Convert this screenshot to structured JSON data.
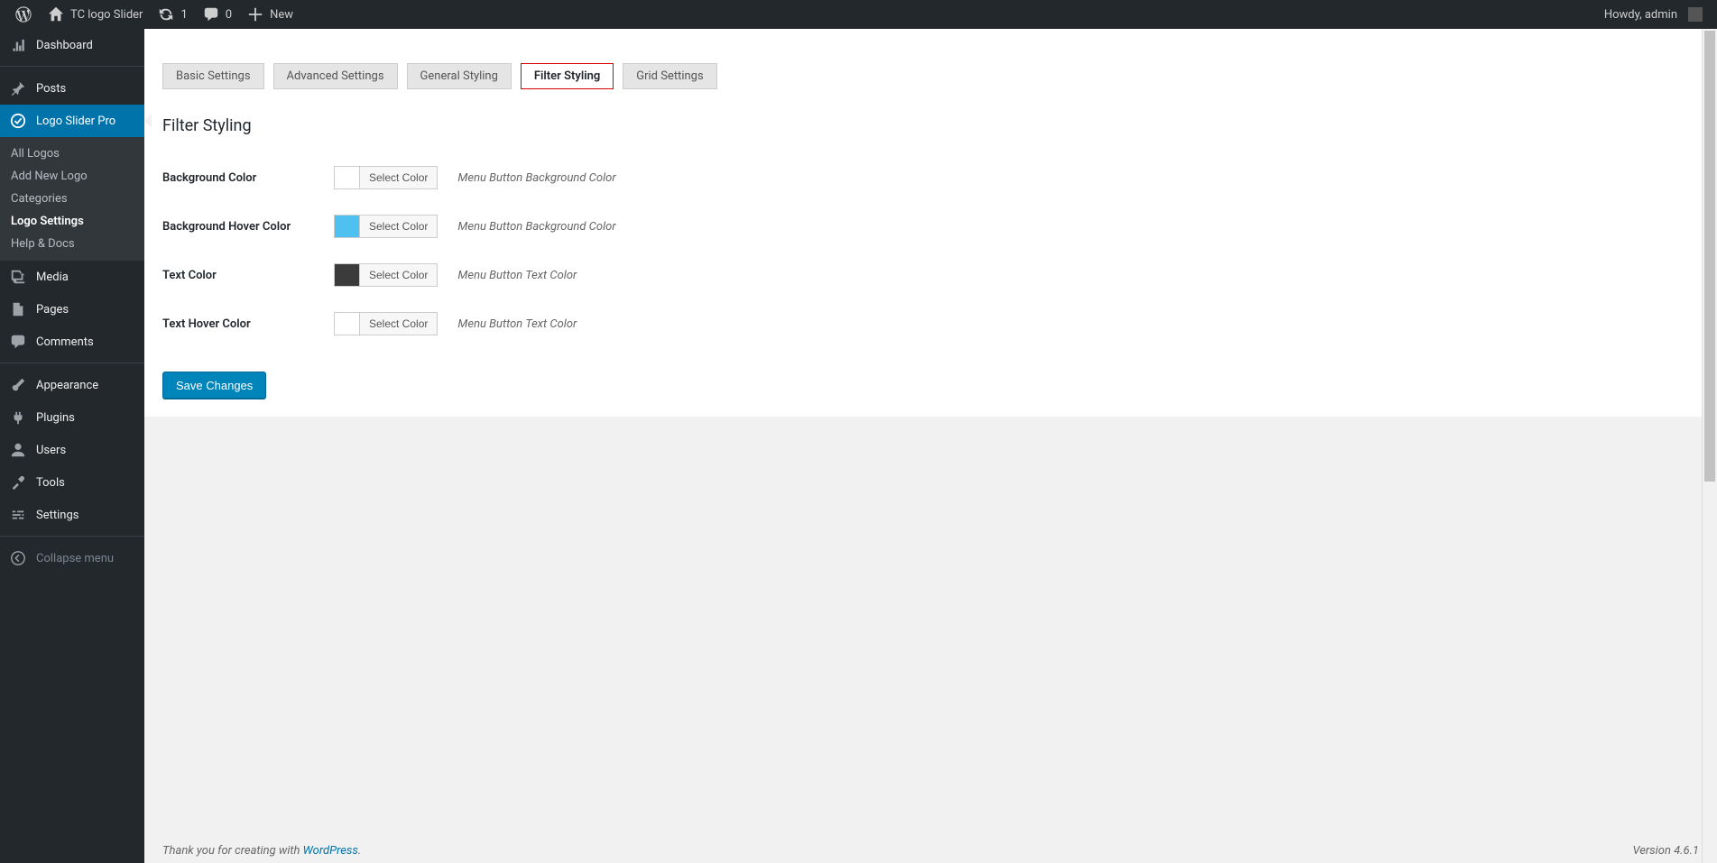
{
  "adminbar": {
    "site_name": "TC logo Slider",
    "updates": "1",
    "comments": "0",
    "new_label": "New",
    "greeting": "Howdy, admin"
  },
  "sidebar": {
    "dashboard": "Dashboard",
    "posts": "Posts",
    "logo_slider": "Logo Slider Pro",
    "submenu": {
      "all_logos": "All Logos",
      "add_new": "Add New Logo",
      "categories": "Categories",
      "settings": "Logo Settings",
      "help": "Help & Docs"
    },
    "media": "Media",
    "pages": "Pages",
    "comments": "Comments",
    "appearance": "Appearance",
    "plugins": "Plugins",
    "users": "Users",
    "tools": "Tools",
    "settings": "Settings",
    "collapse": "Collapse menu"
  },
  "tabs": {
    "basic": "Basic Settings",
    "advanced": "Advanced Settings",
    "general": "General Styling",
    "filter": "Filter Styling",
    "grid": "Grid Settings"
  },
  "section": {
    "title": "Filter Styling"
  },
  "fields": {
    "bg_color": {
      "label": "Background Color",
      "btn": "Select Color",
      "desc": "Menu Button Background Color",
      "swatch": "#ffffff"
    },
    "bg_hover": {
      "label": "Background Hover Color",
      "btn": "Select Color",
      "desc": "Menu Button Background Color",
      "swatch": "#4fc1f0"
    },
    "text_color": {
      "label": "Text Color",
      "btn": "Select Color",
      "desc": "Menu Button Text Color",
      "swatch": "#3b3b3b"
    },
    "text_hover": {
      "label": "Text Hover Color",
      "btn": "Select Color",
      "desc": "Menu Button Text Color",
      "swatch": "#ffffff"
    }
  },
  "actions": {
    "save": "Save Changes"
  },
  "footer": {
    "thank_prefix": "Thank you for creating with ",
    "wp_link": "WordPress",
    "thank_suffix": ".",
    "version": "Version 4.6.1"
  }
}
